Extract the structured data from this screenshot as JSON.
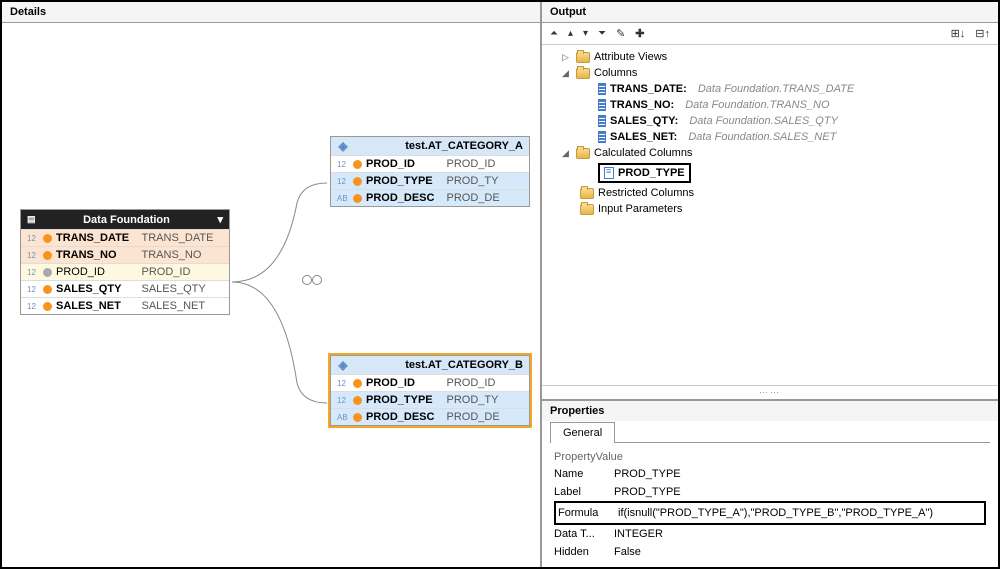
{
  "leftPanel": {
    "title": "Details",
    "dataFoundation": {
      "title": "Data Foundation",
      "rows": [
        {
          "type": "12",
          "dot": "orange",
          "name": "TRANS_DATE",
          "alias": "TRANS_DATE",
          "rowClass": "selA"
        },
        {
          "type": "12",
          "dot": "orange",
          "name": "TRANS_NO",
          "alias": "TRANS_NO",
          "rowClass": "selA"
        },
        {
          "type": "12",
          "dot": "gray",
          "name": "PROD_ID",
          "alias": "PROD_ID",
          "rowClass": "selB"
        },
        {
          "type": "12",
          "dot": "orange",
          "name": "SALES_QTY",
          "alias": "SALES_QTY",
          "rowClass": ""
        },
        {
          "type": "12",
          "dot": "orange",
          "name": "SALES_NET",
          "alias": "SALES_NET",
          "rowClass": ""
        }
      ]
    },
    "categoryA": {
      "title": "test.AT_CATEGORY_A",
      "rows": [
        {
          "type": "12",
          "dot": "orange",
          "name": "PROD_ID",
          "alias": "PROD_ID",
          "rowClass": ""
        },
        {
          "type": "12",
          "dot": "orange",
          "name": "PROD_TYPE",
          "alias": "PROD_TY",
          "rowClass": "selC"
        },
        {
          "type": "AB",
          "dot": "orange",
          "name": "PROD_DESC",
          "alias": "PROD_DE",
          "rowClass": "selC"
        }
      ]
    },
    "categoryB": {
      "title": "test.AT_CATEGORY_B",
      "rows": [
        {
          "type": "12",
          "dot": "orange",
          "name": "PROD_ID",
          "alias": "PROD_ID",
          "rowClass": ""
        },
        {
          "type": "12",
          "dot": "orange",
          "name": "PROD_TYPE",
          "alias": "PROD_TY",
          "rowClass": "selC"
        },
        {
          "type": "AB",
          "dot": "orange",
          "name": "PROD_DESC",
          "alias": "PROD_DE",
          "rowClass": "selC"
        }
      ]
    }
  },
  "outputPanel": {
    "title": "Output",
    "tree": {
      "attributeViews": "Attribute Views",
      "columns": "Columns",
      "columnItems": [
        {
          "name": "TRANS_DATE:",
          "desc": "Data Foundation.TRANS_DATE"
        },
        {
          "name": "TRANS_NO:",
          "desc": "Data Foundation.TRANS_NO"
        },
        {
          "name": "SALES_QTY:",
          "desc": "Data Foundation.SALES_QTY"
        },
        {
          "name": "SALES_NET:",
          "desc": "Data Foundation.SALES_NET"
        }
      ],
      "calculatedColumns": "Calculated Columns",
      "calcItem": "PROD_TYPE",
      "restrictedColumns": "Restricted Columns",
      "inputParameters": "Input Parameters"
    }
  },
  "propertiesPanel": {
    "title": "Properties",
    "tab": "General",
    "headerProperty": "Property",
    "headerValue": "Value",
    "rows": [
      {
        "name": "Name",
        "value": "PROD_TYPE"
      },
      {
        "name": "Label",
        "value": "PROD_TYPE"
      },
      {
        "name": "Formula",
        "value": "if(isnull(\"PROD_TYPE_A\"),\"PROD_TYPE_B\",\"PROD_TYPE_A\")"
      },
      {
        "name": "Data T...",
        "value": "INTEGER"
      },
      {
        "name": "Hidden",
        "value": "False"
      }
    ]
  }
}
